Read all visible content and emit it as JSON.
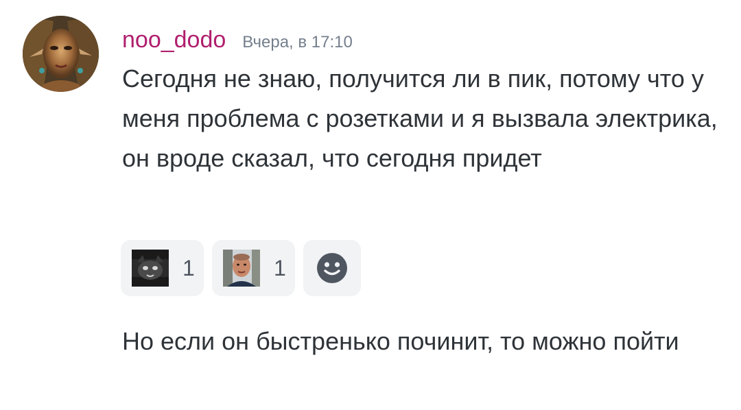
{
  "message": {
    "author": "noo_dodo",
    "author_color": "#b01e6e",
    "timestamp": "Вчера, в 17:10",
    "text_1": "Сегодня не знаю, получится ли в пик, потому что у меня проблема с розетками и я вызвала электрика, он вроде сказал, что сегодня придет",
    "text_2": "Но если он быстренько починит, то можно пойти"
  },
  "reactions": [
    {
      "icon": "cat-face-emoji",
      "count": "1"
    },
    {
      "icon": "man-face-emoji",
      "count": "1"
    }
  ],
  "add_reaction_icon": "smiley-face-icon"
}
